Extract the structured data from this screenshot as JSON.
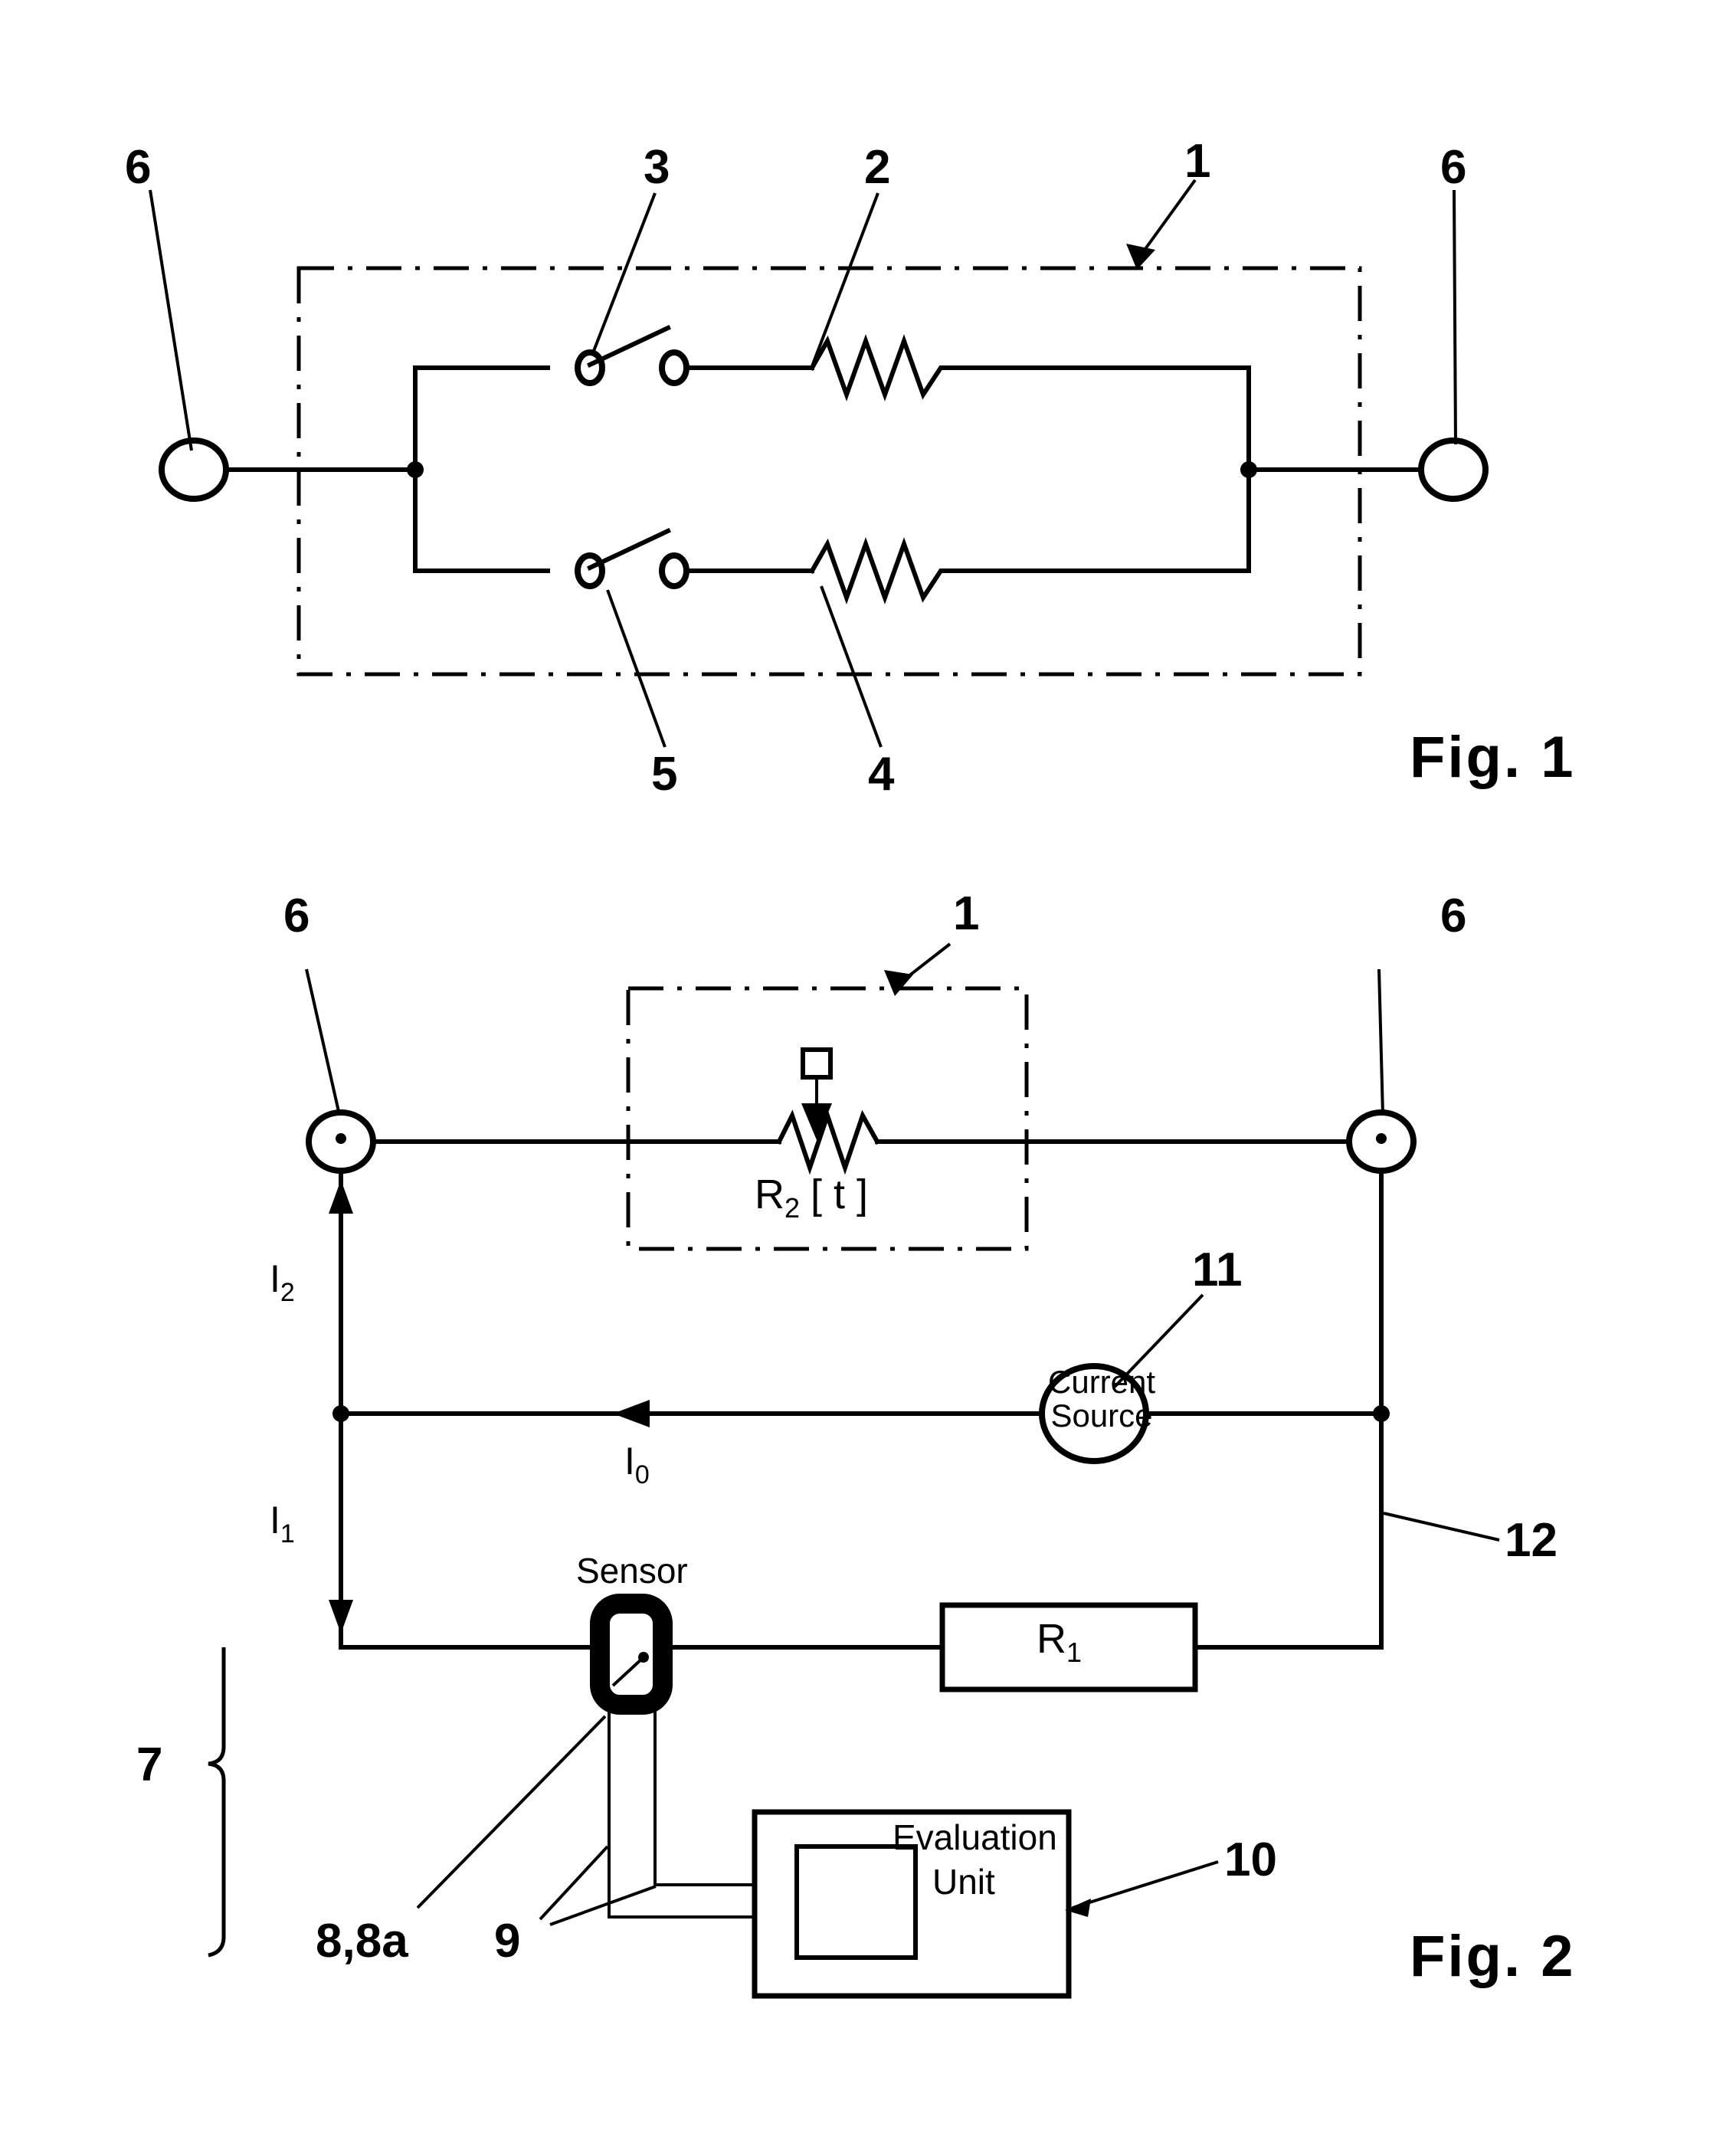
{
  "document": {
    "type": "patent-drawing-sheet",
    "figures": [
      {
        "caption": "Fig. 1",
        "reference_numerals": [
          "6",
          "3",
          "2",
          "1",
          "6",
          "5",
          "4"
        ],
        "description_parts": {
          "1": "dash-dot enclosure (module / housing)",
          "2": "upper resistor branch",
          "3": "upper switch",
          "4": "lower resistor branch",
          "5": "lower switch",
          "6": "external terminal"
        }
      },
      {
        "caption": "Fig. 2",
        "reference_numerals": [
          "6",
          "1",
          "6",
          "11",
          "12",
          "7",
          "8,8a",
          "9",
          "10"
        ],
        "component_labels": {
          "r2": "R",
          "r2_sub": "2",
          "r2_bracket": "[ t ]",
          "r1": "R",
          "r1_sub": "1",
          "current_source_line1": "Current",
          "current_source_line2": "Source",
          "sensor": "Sensor",
          "evaluation_line1": "Evaluation",
          "evaluation_line2": "Unit"
        },
        "current_labels": {
          "i2": "I",
          "i2_sub": "2",
          "i0": "I",
          "i0_sub": "0",
          "i1": "I",
          "i1_sub": "1"
        }
      }
    ]
  },
  "fig1": {
    "caption": "Fig. 1",
    "numerals": {
      "left_terminal": "6",
      "upper_switch": "3",
      "upper_resistor": "2",
      "enclosure": "1",
      "right_terminal": "6",
      "lower_switch": "5",
      "lower_resistor": "4"
    }
  },
  "fig2": {
    "caption": "Fig. 2",
    "numerals": {
      "left_terminal": "6",
      "enclosure": "1",
      "right_terminal": "6",
      "current_source": "11",
      "line_12": "12",
      "measuring_branch": "7",
      "sensor_ref": "8,8a",
      "leads_ref": "9",
      "evaluation_unit_ref": "10"
    },
    "labels": {
      "r2_main": "R",
      "r2_sub": "2",
      "r2_arg": "[ t ]",
      "r1_main": "R",
      "r1_sub": "1",
      "current_source_l1": "Current",
      "current_source_l2": "Source",
      "sensor": "Sensor",
      "eval_l1": "Evaluation",
      "eval_l2": "Unit",
      "i2_main": "I",
      "i2_sub": "2",
      "i0_main": "I",
      "i0_sub": "0",
      "i1_main": "I",
      "i1_sub": "1"
    }
  },
  "colors": {
    "ink": "#000000",
    "paper": "#ffffff"
  }
}
